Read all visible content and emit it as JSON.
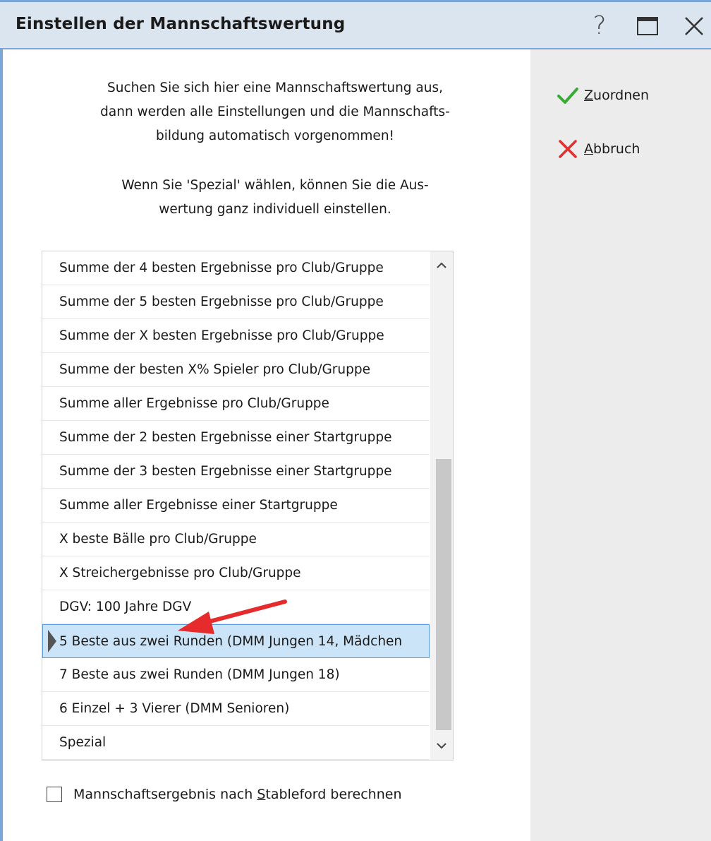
{
  "window": {
    "title": "Einstellen der Mannschaftswertung",
    "help_label": "?"
  },
  "intro": {
    "line1": "Suchen Sie sich hier eine Mannschaftswertung aus,",
    "line2": "dann werden alle Einstellungen und die Mannschafts-",
    "line3": "bildung automatisch vorgenommen!",
    "line4": "Wenn Sie 'Spezial' wählen, können Sie die Aus-",
    "line5": "wertung ganz individuell einstellen."
  },
  "actions": {
    "assign_accel": "Z",
    "assign_rest": "uordnen",
    "cancel_accel": "A",
    "cancel_rest": "bbruch"
  },
  "list": {
    "items": [
      "Summe der 4 besten Ergebnisse pro Club/Gruppe",
      "Summe der 5 besten Ergebnisse pro Club/Gruppe",
      "Summe der X besten Ergebnisse pro Club/Gruppe",
      "Summe der besten X% Spieler pro Club/Gruppe",
      "Summe aller Ergebnisse pro Club/Gruppe",
      "Summe der 2 besten Ergebnisse einer Startgruppe",
      "Summe der 3 besten Ergebnisse einer Startgruppe",
      "Summe aller Ergebnisse einer Startgruppe",
      "X beste Bälle pro Club/Gruppe",
      "X Streichergebnisse pro Club/Gruppe",
      "DGV: 100 Jahre DGV",
      "5 Beste aus zwei Runden (DMM Jungen 14, Mädchen",
      "7 Beste aus zwei Runden (DMM Jungen 18)",
      "6 Einzel + 3 Vierer (DMM Senioren)",
      "Spezial"
    ],
    "selected_index": 11
  },
  "checkbox": {
    "label_before": "Mannschaftsergebnis nach ",
    "label_accel": "S",
    "label_after": "tableford berechnen",
    "checked": false
  },
  "colors": {
    "titlebar_bg": "#dbe5f0",
    "frame": "#7aa6d8",
    "selected_bg": "#cce4f7",
    "check_green": "#3aa935",
    "cancel_red": "#e03030",
    "arrow_red": "#e52b2b"
  },
  "icons": {
    "help": "question-mark",
    "maximize": "maximize-icon",
    "close": "close-icon",
    "assign": "checkmark-icon",
    "cancel": "cross-icon"
  }
}
